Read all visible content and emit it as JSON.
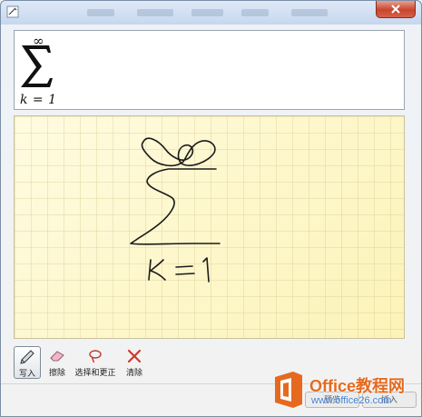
{
  "window": {
    "close_label": "×"
  },
  "preview": {
    "upper_limit": "∞",
    "lower_limit": "k = 1"
  },
  "toolbar": {
    "items": [
      {
        "label": "写入",
        "icon": "pen-icon",
        "active": true
      },
      {
        "label": "擦除",
        "icon": "eraser-icon",
        "active": false
      },
      {
        "label": "选择和更正",
        "icon": "lasso-icon",
        "active": false
      },
      {
        "label": "清除",
        "icon": "clear-icon",
        "active": false
      }
    ]
  },
  "bottom_buttons": {
    "preview_label": "预览",
    "insert_label": "插入"
  },
  "watermark": {
    "brand": "Office教程网",
    "url": "www.office26.com"
  },
  "colors": {
    "pad_background": "#fdf7c8",
    "ink": "#1a1a1a",
    "brand_orange": "#e56a1f",
    "close_red": "#c8452c"
  }
}
